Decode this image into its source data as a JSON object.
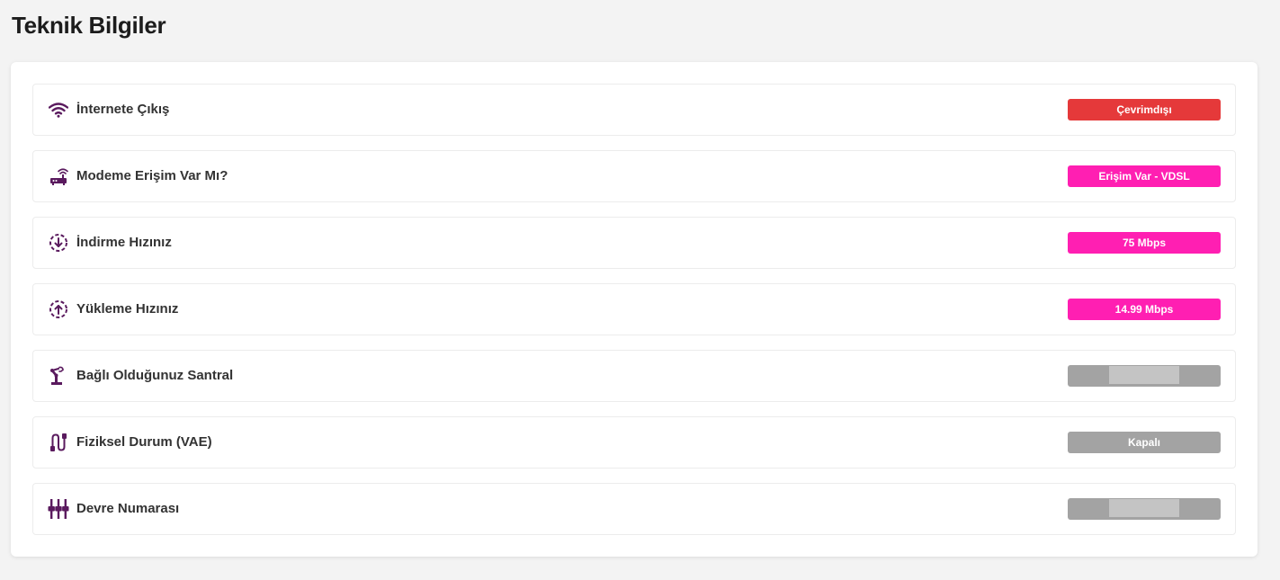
{
  "page": {
    "title": "Teknik Bilgiler"
  },
  "colors": {
    "icon": "#5a1a5e",
    "status_red": "#e5393a",
    "status_pink": "#ff1fb2",
    "status_gray": "#a3a3a3"
  },
  "rows": [
    {
      "icon": "wifi-icon",
      "label": "İnternete Çıkış",
      "value": "Çevrimdışı",
      "status": "red"
    },
    {
      "icon": "router-icon",
      "label": "Modeme Erişim Var Mı?",
      "value": "Erişim Var - VDSL",
      "status": "pink"
    },
    {
      "icon": "download-icon",
      "label": "İndirme Hızınız",
      "value": "75 Mbps",
      "status": "pink"
    },
    {
      "icon": "upload-icon",
      "label": "Yükleme Hızınız",
      "value": "14.99 Mbps",
      "status": "pink"
    },
    {
      "icon": "robot-arm-icon",
      "label": "Bağlı Olduğunuz Santral",
      "value": "",
      "status": "gray",
      "redacted": true
    },
    {
      "icon": "cable-icon",
      "label": "Fiziksel Durum (VAE)",
      "value": "Kapalı",
      "status": "gray"
    },
    {
      "icon": "equalizer-icon",
      "label": "Devre Numarası",
      "value": "",
      "status": "gray",
      "redacted": true
    }
  ]
}
